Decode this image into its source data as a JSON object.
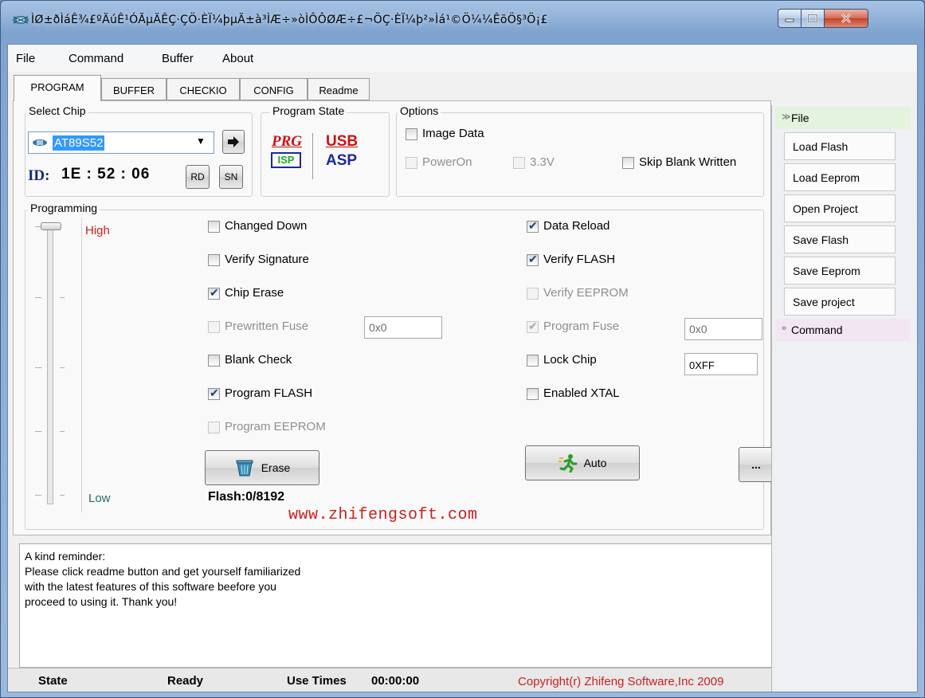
{
  "window": {
    "title": "ÌØ±ðÌáÊ¾£ºÄúÊ¹ÓÃµÄÊÇ·ÇÖ·ÈÏ¼þµÄ±à³ÌÆ÷»òÌÔÔØÆ÷£¬ÖÇ·ÈÏ¼þ²»Ìá¹©Ö¼¼ÊõÖ§³Ö¡£"
  },
  "menu": [
    "File",
    "Command",
    "Buffer",
    "About"
  ],
  "tabs": [
    "PROGRAM",
    "BUFFER",
    "CHECKIO",
    "CONFIG",
    "Readme"
  ],
  "select_chip": {
    "title": "Select Chip",
    "chip": "AT89S52",
    "id_label": "ID:",
    "id_value": "1E : 52 : 06",
    "rd": "RD",
    "sn": "SN"
  },
  "program_state": {
    "title": "Program State",
    "prg": "PRG",
    "isp": "ISP",
    "usb": "USB",
    "asp": "ASP"
  },
  "options": {
    "title": "Options",
    "image_data": {
      "label": "Image Data",
      "checked": false
    },
    "power_on": {
      "label": "PowerOn",
      "checked": false
    },
    "v33": {
      "label": "3.3V",
      "checked": false
    },
    "skip_blank": {
      "label": "Skip Blank Written",
      "checked": false
    }
  },
  "programming": {
    "title": "Programming",
    "high": "High",
    "low": "Low",
    "slider_level": 1.0,
    "left": [
      {
        "label": "Changed Down",
        "checked": false,
        "disabled": false
      },
      {
        "label": "Verify Signature",
        "checked": false,
        "disabled": false
      },
      {
        "label": "Chip Erase",
        "checked": true,
        "disabled": false
      },
      {
        "label": "Prewritten Fuse",
        "checked": false,
        "disabled": true
      },
      {
        "label": "Blank Check",
        "checked": false,
        "disabled": false
      },
      {
        "label": "Program FLASH",
        "checked": true,
        "disabled": false
      },
      {
        "label": "Program EEPROM",
        "checked": false,
        "disabled": true
      }
    ],
    "right": [
      {
        "label": "Data Reload",
        "checked": true,
        "disabled": false
      },
      {
        "label": "Verify FLASH",
        "checked": true,
        "disabled": false
      },
      {
        "label": "Verify EEPROM",
        "checked": false,
        "disabled": true
      },
      {
        "label": "Program Fuse",
        "checked": true,
        "disabled": true
      },
      {
        "label": "Lock Chip",
        "checked": false,
        "disabled": false
      },
      {
        "label": "Enabled XTAL",
        "checked": false,
        "disabled": false
      }
    ],
    "prewritten_fuse_value": "0x0",
    "program_fuse_value": "0x0",
    "lock_value": "0XFF",
    "erase": "Erase",
    "auto": "Auto",
    "more": "...",
    "flash": "Flash:0/8192"
  },
  "website": "www.zhifengsoft.com",
  "reminder": "A kind reminder:\nPlease click readme button and get yourself familiarized\nwith the latest features of this software beefore you\nproceed to using it. Thank you!",
  "side": {
    "file_header": "File",
    "buttons": [
      "Load Flash",
      "Load Eeprom",
      "Open Project",
      "Save Flash",
      "Save Eeprom",
      "Save project"
    ],
    "command_header": "Command"
  },
  "status": {
    "state_label": "State",
    "state_value": "Ready",
    "use_times_label": "Use Times",
    "use_times_value": "00:00:00",
    "copyright": "Copyright(r) Zhifeng Software,Inc 2009"
  },
  "colors": {
    "accent_red": "#cc1f1f",
    "link_blue": "#1c5fbf",
    "selection": "#3399ff"
  }
}
